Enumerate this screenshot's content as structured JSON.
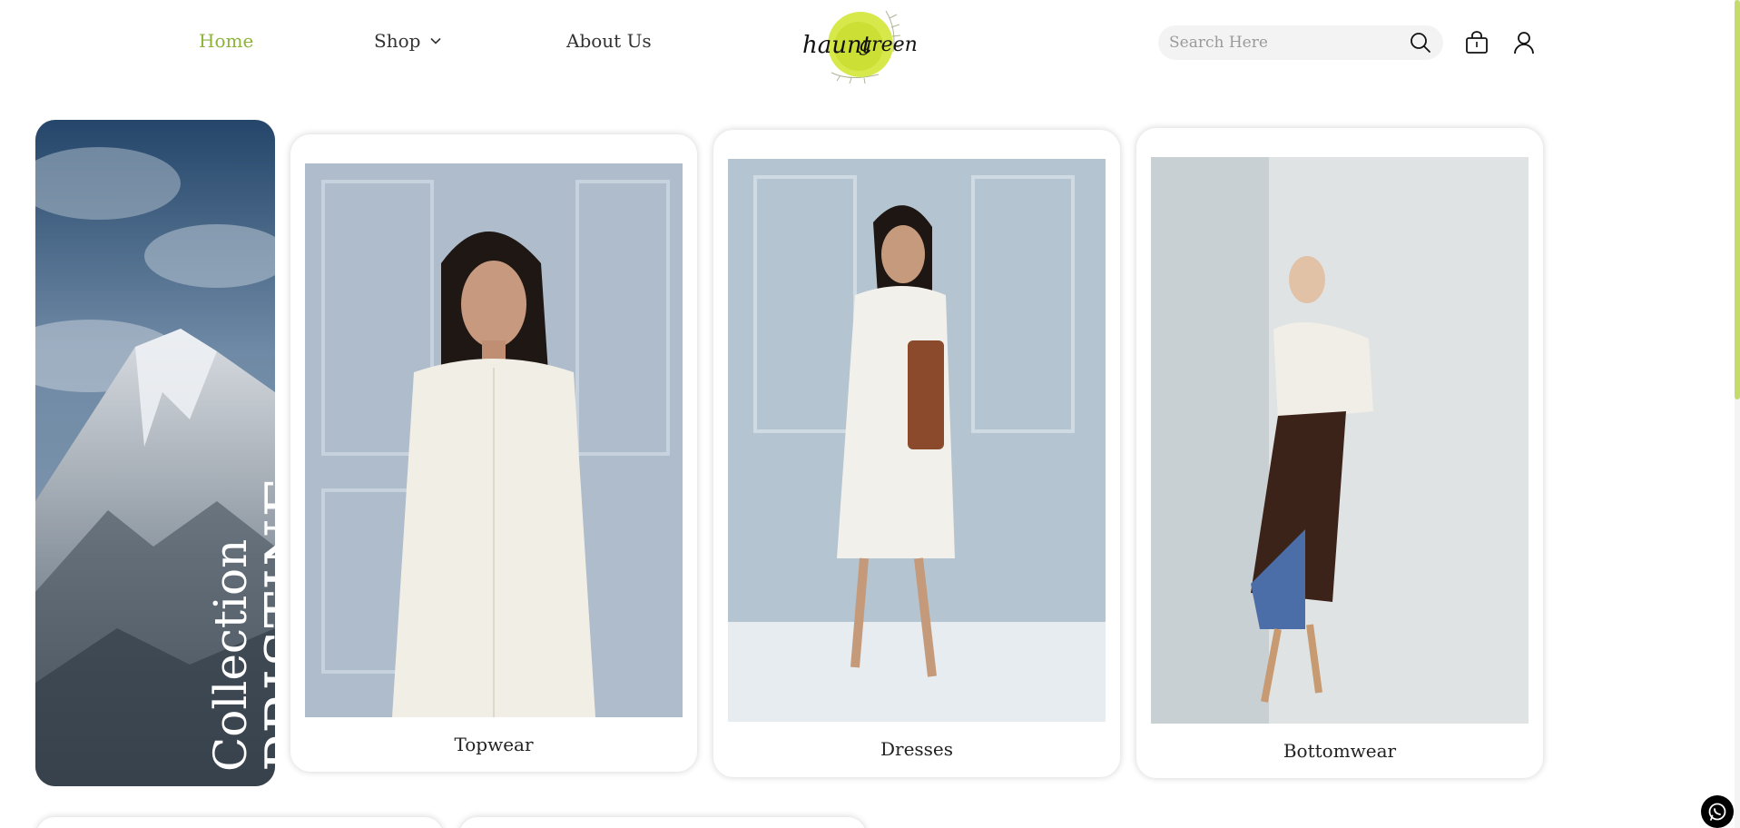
{
  "header": {
    "nav": {
      "home": "Home",
      "shop": "Shop",
      "about": "About Us"
    },
    "logo_text": "haunt green",
    "search": {
      "placeholder": "Search Here",
      "value": ""
    },
    "icons": {
      "search": "search-icon",
      "cart": "cart-icon",
      "user": "user-icon",
      "shop_dropdown": "chevron-down-icon"
    }
  },
  "colors": {
    "accent": "#8db33a",
    "logo_circle": "#d7e84b",
    "scrollbar": "#c3dc6c"
  },
  "banner": {
    "label_small": "Collection",
    "label_big": "PRISTINE"
  },
  "categories": [
    {
      "label": "Topwear"
    },
    {
      "label": "Dresses"
    },
    {
      "label": "Bottomwear"
    }
  ],
  "floating": {
    "chat_icon": "whatsapp-icon"
  }
}
